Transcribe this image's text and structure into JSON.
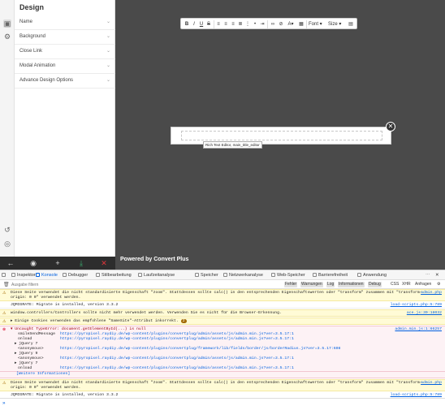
{
  "panel": {
    "title": "Design",
    "sections": [
      {
        "label": "Name"
      },
      {
        "label": "Background"
      },
      {
        "label": "Close Link"
      },
      {
        "label": "Modal Animation"
      },
      {
        "label": "Advance Design Options"
      }
    ]
  },
  "canvas": {
    "toolbar": {
      "font_label": "Font",
      "size_label": "Size"
    },
    "editor_tooltip": "Rich Text Editor, main_title_editor",
    "powered_by": "Powered by Convert Plus"
  },
  "devtools": {
    "tabs": [
      {
        "label": "Inspektor"
      },
      {
        "label": "Konsole"
      },
      {
        "label": "Debugger"
      },
      {
        "label": "Stilbearbeitung"
      },
      {
        "label": "Laufzeitanalyse"
      },
      {
        "label": "Speicher"
      },
      {
        "label": "Netzwerkanalyse"
      },
      {
        "label": "Web-Speicher"
      },
      {
        "label": "Barrierefreiheit"
      },
      {
        "label": "Anwendung"
      }
    ],
    "filter_placeholder": "Ausgabe filtern",
    "filter_buttons": [
      "Fehler",
      "Warnungen",
      "Log",
      "Informationen",
      "Debug",
      "CSS",
      "XHR",
      "Anfragen"
    ],
    "messages": [
      {
        "type": "warn",
        "text": "Diese Seite verwendet die nicht standardisierte Eigenschaft \"zoom\". Stattdessen sollte calc() in den entsprechenden Eigenschaftswerten oder \"transform\" zusammen mit \"transform-\norigin: 0 0\" verwendet werden.",
        "src": "admin.php"
      },
      {
        "type": "log",
        "text": "JQMIGRATE: Migrate is installed, version 3.3.2",
        "src": "load-scripts.php:5:789"
      },
      {
        "type": "warn",
        "text": "window.controllers/Controllers sollte nicht mehr verwendet werden. Verwenden Sie es nicht für die Browser-Erkennung.",
        "src": "ace.js:30:18032"
      },
      {
        "type": "warn",
        "text": "Einige Cookies verwenden das empfohlene \"SameSite\"-Attribut inkorrekt.",
        "src": "",
        "badge": "2"
      },
      {
        "type": "err",
        "text": "Uncaught TypeError: document.getElementById(...) is null",
        "src": "admin.min.js:1:66257"
      },
      {
        "type": "warn",
        "text": "Diese Seite verwendet die nicht standardisierte Eigenschaft \"zoom\". Stattdessen sollte calc() in den entsprechenden Eigenschaftswerten oder \"transform\" zusammen mit \"transform-\norigin: 0 0\" verwendet werden.",
        "src": "admin.php"
      },
      {
        "type": "log",
        "text": "JQMIGRATE: Migrate is installed, version 3.3.2",
        "src": "load-scripts.php:5:789"
      }
    ],
    "trace": [
      {
        "fn": "smileSendMessage",
        "url": "https://pyropixel.raydiy.de/wp-content/plugins/convertplug/admin/assets/js/admin.min.js?ver=3.5.17:1"
      },
      {
        "fn": "onload",
        "url": "https://pyropixel.raydiy.de/wp-content/plugins/convertplug/admin/assets/js/admin.min.js?ver=3.5.17:1"
      },
      {
        "fn": "jQuery 7",
        "url": ""
      },
      {
        "fn": "<anonymous>",
        "url": "https://pyropixel.raydiy.de/wp-content/plugins/convertplug/framework/lib/fields/border/js/borderRadius.js?ver=3.5.17:608"
      },
      {
        "fn": "jQuery 9",
        "url": ""
      },
      {
        "fn": "<anonymous>",
        "url": "https://pyropixel.raydiy.de/wp-content/plugins/convertplug/admin/assets/js/admin.min.js?ver=3.5.17:1"
      },
      {
        "fn": "jQuery 7",
        "url": ""
      },
      {
        "fn": "onload",
        "url": "https://pyropixel.raydiy.de/wp-content/plugins/convertplug/admin/assets/js/admin.min.js?ver=3.5.17:1"
      }
    ],
    "more_info": "[Weitere Informationen]"
  },
  "colors": {
    "canvas_bg": "#4a4a4a",
    "accent": "#0060df",
    "warning_bg": "#fffbd6",
    "error_bg": "#fdf2f5"
  }
}
